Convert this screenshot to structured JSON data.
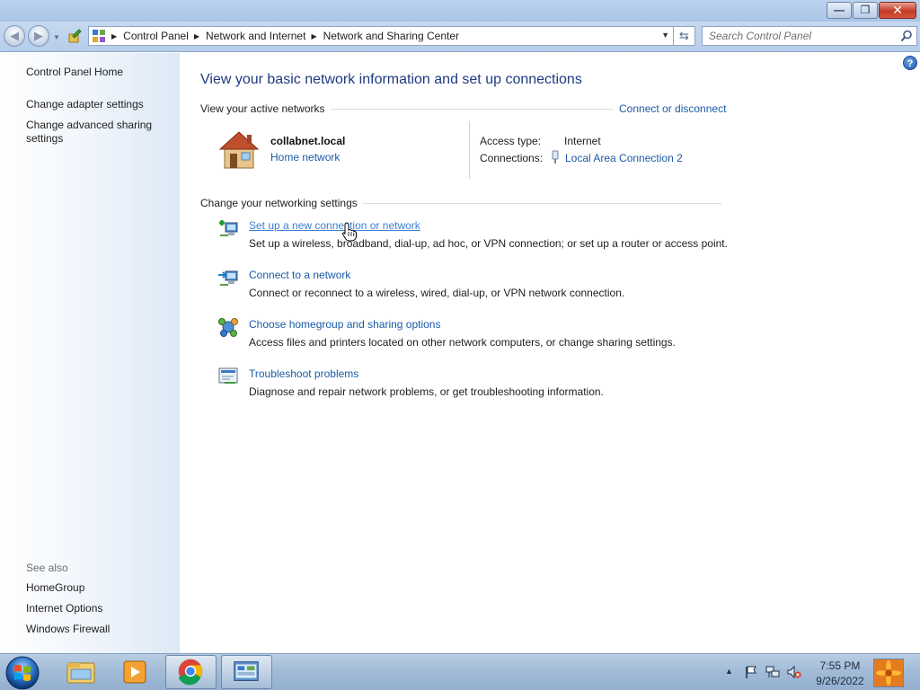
{
  "window": {
    "minimize_glyph": "—",
    "maximize_glyph": "❐",
    "close_glyph": "✕"
  },
  "navbar": {
    "back_icon": "back-arrow-icon",
    "forward_icon": "forward-arrow-icon",
    "breadcrumbs": [
      "Control Panel",
      "Network and Internet",
      "Network and Sharing Center"
    ],
    "search_placeholder": "Search Control Panel"
  },
  "sidebar": {
    "home": "Control Panel Home",
    "links": [
      "Change adapter settings",
      "Change advanced sharing settings"
    ],
    "see_also_label": "See also",
    "see_also": [
      "HomeGroup",
      "Internet Options",
      "Windows Firewall"
    ]
  },
  "main": {
    "heading": "View your basic network information and set up connections",
    "active_networks_label": "View your active networks",
    "connect_disconnect": "Connect or disconnect",
    "network": {
      "name": "collabnet.local",
      "type": "Home network",
      "access_type_label": "Access type:",
      "access_type": "Internet",
      "connections_label": "Connections:",
      "connection": "Local Area Connection 2"
    },
    "settings_label": "Change your networking settings",
    "tasks": [
      {
        "title": "Set up a new connection or network",
        "desc": "Set up a wireless, broadband, dial-up, ad hoc, or VPN connection; or set up a router or access point."
      },
      {
        "title": "Connect to a network",
        "desc": "Connect or reconnect to a wireless, wired, dial-up, or VPN network connection."
      },
      {
        "title": "Choose homegroup and sharing options",
        "desc": "Access files and printers located on other network computers, or change sharing settings."
      },
      {
        "title": "Troubleshoot problems",
        "desc": "Diagnose and repair network problems, or get troubleshooting information."
      }
    ]
  },
  "taskbar": {
    "time": "7:55 PM",
    "date": "9/26/2022",
    "pinned": [
      "windows-explorer",
      "media-player",
      "chrome",
      "control-panel"
    ]
  },
  "colors": {
    "link": "#1a5aa8",
    "heading": "#1e3a82",
    "taskbar": "#a3bcd8"
  }
}
